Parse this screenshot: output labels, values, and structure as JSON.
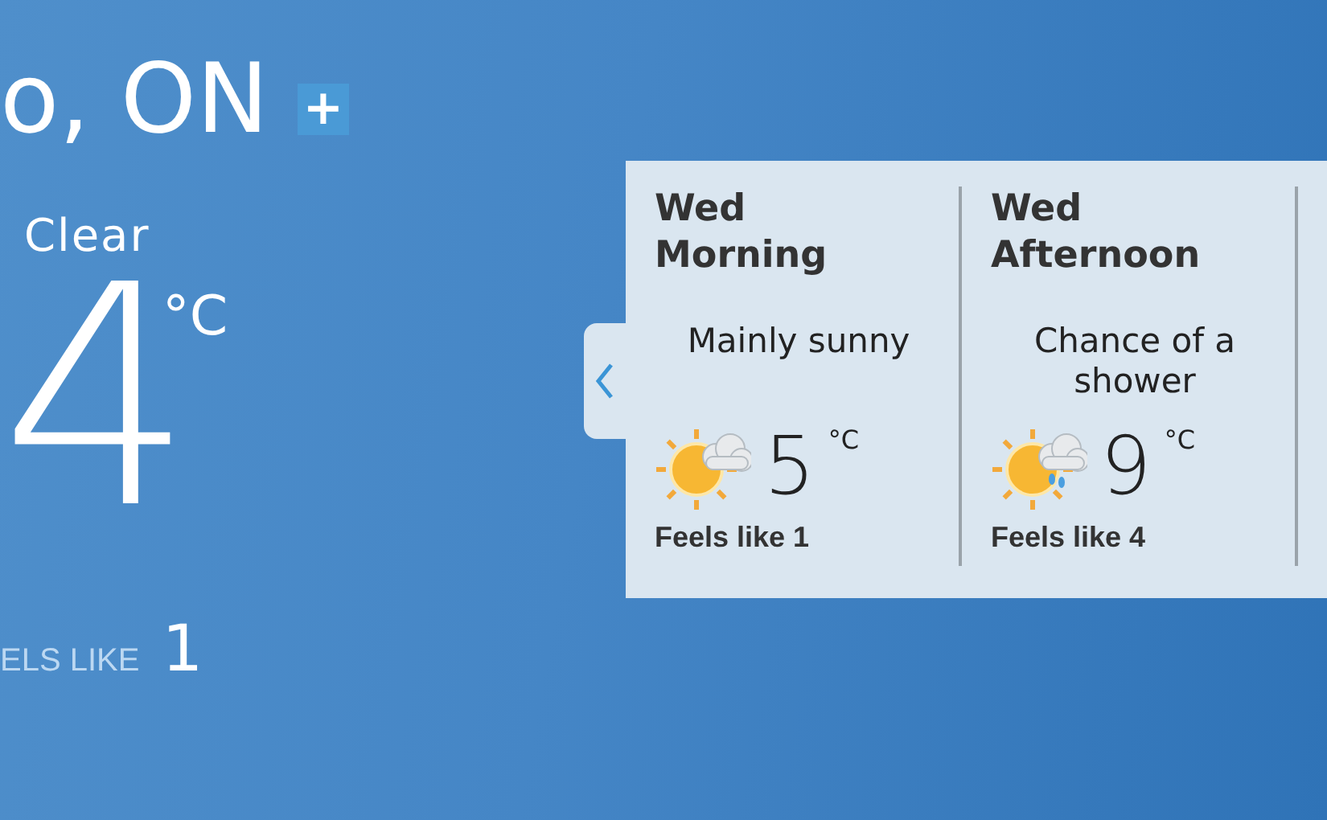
{
  "location": {
    "title": "o, ON",
    "add_button": "+"
  },
  "current": {
    "condition": "Clear",
    "temperature": "4",
    "unit": "°C",
    "feels_like_label": "ELS LIKE",
    "feels_like": "1"
  },
  "forecast": [
    {
      "day": "Wed",
      "period": "Morning",
      "condition": "Mainly sunny",
      "kind": "sun-cloud",
      "temperature": "5",
      "unit": "°C",
      "feels_like": "Feels like 1"
    },
    {
      "day": "Wed",
      "period": "Afternoon",
      "condition": "Chance of a shower",
      "kind": "sun-cloud-rain",
      "temperature": "9",
      "unit": "°C",
      "feels_like": "Feels like 4"
    }
  ]
}
